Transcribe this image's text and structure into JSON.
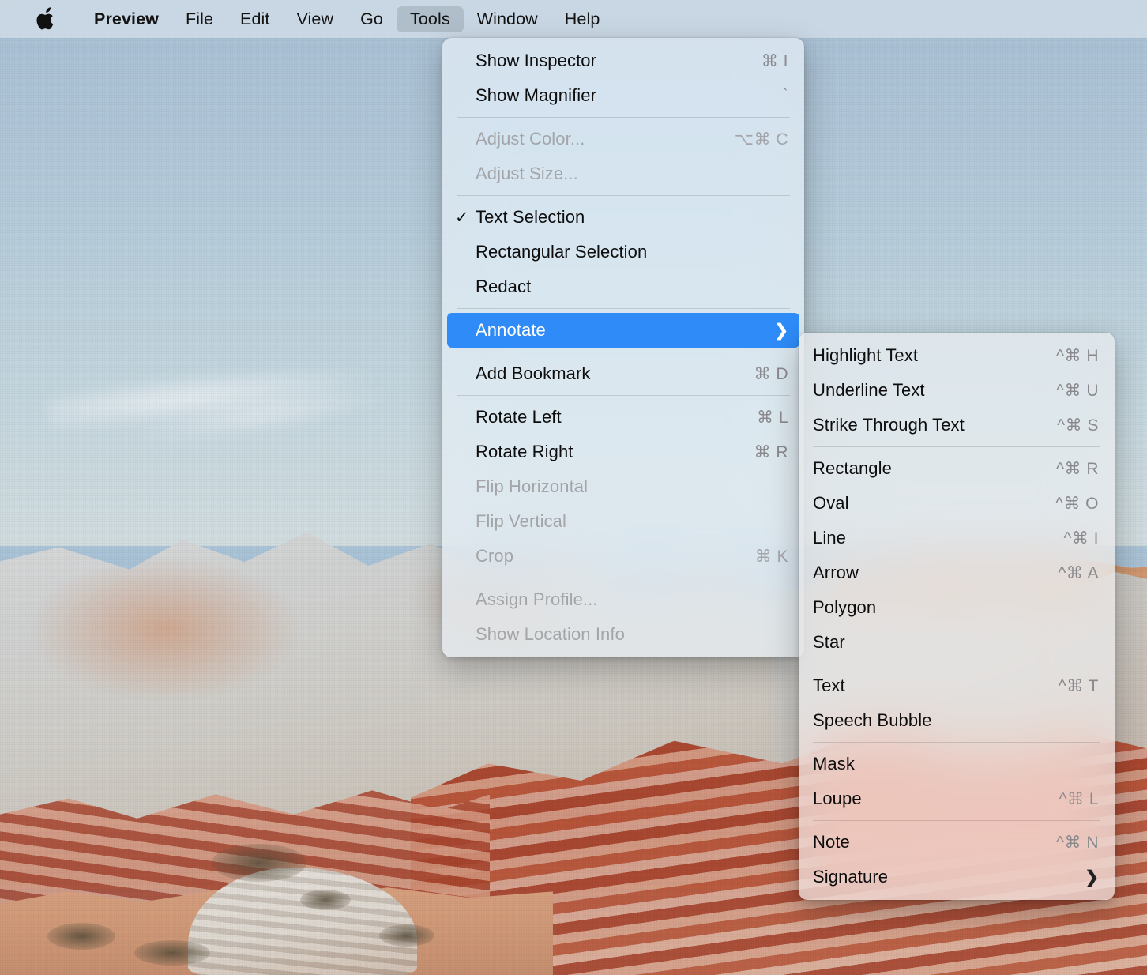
{
  "menubar": {
    "apple_icon": "apple-logo-icon",
    "items": [
      {
        "label": "Preview",
        "bold": true,
        "active": false
      },
      {
        "label": "File",
        "bold": false,
        "active": false
      },
      {
        "label": "Edit",
        "bold": false,
        "active": false
      },
      {
        "label": "View",
        "bold": false,
        "active": false
      },
      {
        "label": "Go",
        "bold": false,
        "active": false
      },
      {
        "label": "Tools",
        "bold": false,
        "active": true
      },
      {
        "label": "Window",
        "bold": false,
        "active": false
      },
      {
        "label": "Help",
        "bold": false,
        "active": false
      }
    ]
  },
  "tools_menu": {
    "title": "Tools",
    "items": [
      {
        "type": "item",
        "label": "Show Inspector",
        "shortcut": "⌘ I",
        "checked": false,
        "disabled": false,
        "selected": false,
        "submenu": false
      },
      {
        "type": "item",
        "label": "Show Magnifier",
        "shortcut": "`",
        "checked": false,
        "disabled": false,
        "selected": false,
        "submenu": false
      },
      {
        "type": "separator"
      },
      {
        "type": "item",
        "label": "Adjust Color...",
        "shortcut": "⌥⌘ C",
        "checked": false,
        "disabled": true,
        "selected": false,
        "submenu": false
      },
      {
        "type": "item",
        "label": "Adjust Size...",
        "shortcut": "",
        "checked": false,
        "disabled": true,
        "selected": false,
        "submenu": false
      },
      {
        "type": "separator"
      },
      {
        "type": "item",
        "label": "Text Selection",
        "shortcut": "",
        "checked": true,
        "disabled": false,
        "selected": false,
        "submenu": false
      },
      {
        "type": "item",
        "label": "Rectangular Selection",
        "shortcut": "",
        "checked": false,
        "disabled": false,
        "selected": false,
        "submenu": false
      },
      {
        "type": "item",
        "label": "Redact",
        "shortcut": "",
        "checked": false,
        "disabled": false,
        "selected": false,
        "submenu": false
      },
      {
        "type": "separator"
      },
      {
        "type": "item",
        "label": "Annotate",
        "shortcut": "",
        "checked": false,
        "disabled": false,
        "selected": true,
        "submenu": true
      },
      {
        "type": "separator"
      },
      {
        "type": "item",
        "label": "Add Bookmark",
        "shortcut": "⌘ D",
        "checked": false,
        "disabled": false,
        "selected": false,
        "submenu": false
      },
      {
        "type": "separator"
      },
      {
        "type": "item",
        "label": "Rotate Left",
        "shortcut": "⌘ L",
        "checked": false,
        "disabled": false,
        "selected": false,
        "submenu": false
      },
      {
        "type": "item",
        "label": "Rotate Right",
        "shortcut": "⌘ R",
        "checked": false,
        "disabled": false,
        "selected": false,
        "submenu": false
      },
      {
        "type": "item",
        "label": "Flip Horizontal",
        "shortcut": "",
        "checked": false,
        "disabled": true,
        "selected": false,
        "submenu": false
      },
      {
        "type": "item",
        "label": "Flip Vertical",
        "shortcut": "",
        "checked": false,
        "disabled": true,
        "selected": false,
        "submenu": false
      },
      {
        "type": "item",
        "label": "Crop",
        "shortcut": "⌘ K",
        "checked": false,
        "disabled": true,
        "selected": false,
        "submenu": false
      },
      {
        "type": "separator"
      },
      {
        "type": "item",
        "label": "Assign Profile...",
        "shortcut": "",
        "checked": false,
        "disabled": true,
        "selected": false,
        "submenu": false
      },
      {
        "type": "item",
        "label": "Show Location Info",
        "shortcut": "",
        "checked": false,
        "disabled": true,
        "selected": false,
        "submenu": false
      }
    ]
  },
  "annotate_submenu": {
    "title": "Annotate",
    "items": [
      {
        "type": "item",
        "label": "Highlight Text",
        "shortcut": "^⌘ H",
        "disabled": false,
        "selected": false,
        "submenu": false
      },
      {
        "type": "item",
        "label": "Underline Text",
        "shortcut": "^⌘ U",
        "disabled": false,
        "selected": false,
        "submenu": false
      },
      {
        "type": "item",
        "label": "Strike Through Text",
        "shortcut": "^⌘ S",
        "disabled": false,
        "selected": false,
        "submenu": false
      },
      {
        "type": "separator"
      },
      {
        "type": "item",
        "label": "Rectangle",
        "shortcut": "^⌘ R",
        "disabled": false,
        "selected": false,
        "submenu": false
      },
      {
        "type": "item",
        "label": "Oval",
        "shortcut": "^⌘ O",
        "disabled": false,
        "selected": false,
        "submenu": false
      },
      {
        "type": "item",
        "label": "Line",
        "shortcut": "^⌘ I",
        "disabled": false,
        "selected": false,
        "submenu": false
      },
      {
        "type": "item",
        "label": "Arrow",
        "shortcut": "^⌘ A",
        "disabled": false,
        "selected": false,
        "submenu": false
      },
      {
        "type": "item",
        "label": "Polygon",
        "shortcut": "",
        "disabled": false,
        "selected": false,
        "submenu": false
      },
      {
        "type": "item",
        "label": "Star",
        "shortcut": "",
        "disabled": false,
        "selected": false,
        "submenu": false
      },
      {
        "type": "separator"
      },
      {
        "type": "item",
        "label": "Text",
        "shortcut": "^⌘ T",
        "disabled": false,
        "selected": false,
        "submenu": false
      },
      {
        "type": "item",
        "label": "Speech Bubble",
        "shortcut": "",
        "disabled": false,
        "selected": false,
        "submenu": false
      },
      {
        "type": "separator"
      },
      {
        "type": "item",
        "label": "Mask",
        "shortcut": "",
        "disabled": false,
        "selected": false,
        "submenu": false
      },
      {
        "type": "item",
        "label": "Loupe",
        "shortcut": "^⌘ L",
        "disabled": false,
        "selected": false,
        "submenu": false
      },
      {
        "type": "separator"
      },
      {
        "type": "item",
        "label": "Note",
        "shortcut": "^⌘ N",
        "disabled": false,
        "selected": false,
        "submenu": false
      },
      {
        "type": "item",
        "label": "Signature",
        "shortcut": "",
        "disabled": false,
        "selected": false,
        "submenu": true
      }
    ]
  },
  "document": {
    "description": "Desert landscape photograph: white and red striated sandstone formations under a pale blue sky"
  },
  "colors": {
    "selection_blue": "#2e8bf7",
    "menu_background": "#e7eef3",
    "menubar_background": "#cedbe6",
    "sky": "#b4c4d0",
    "rock_white": "#d0d2d2",
    "rock_red": "#b2583c",
    "sand": "#d09a79",
    "shortcut_text": "#8a8a8e",
    "label_text": "#0d0d0d",
    "disabled_text": "#a3a5a8"
  }
}
